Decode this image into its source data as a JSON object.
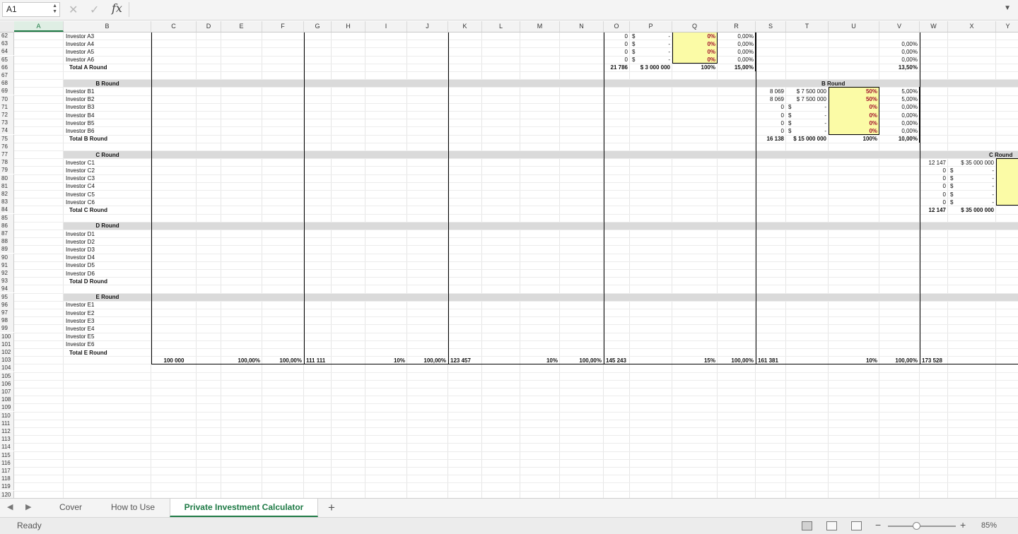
{
  "formula_bar": {
    "cell_ref": "A1",
    "cancel_icon": "✕",
    "enter_icon": "✓",
    "fx_label": "fx",
    "formula": ""
  },
  "columns": [
    {
      "id": "A",
      "w": 70
    },
    {
      "id": "B",
      "w": 124
    },
    {
      "id": "C",
      "w": 64
    },
    {
      "id": "D",
      "w": 35
    },
    {
      "id": "E",
      "w": 58
    },
    {
      "id": "F",
      "w": 59
    },
    {
      "id": "G",
      "w": 39
    },
    {
      "id": "H",
      "w": 48
    },
    {
      "id": "I",
      "w": 59
    },
    {
      "id": "J",
      "w": 58
    },
    {
      "id": "K",
      "w": 48
    },
    {
      "id": "L",
      "w": 54
    },
    {
      "id": "M",
      "w": 56
    },
    {
      "id": "N",
      "w": 62
    },
    {
      "id": "O",
      "w": 37
    },
    {
      "id": "P",
      "w": 60
    },
    {
      "id": "Q",
      "w": 64
    },
    {
      "id": "R",
      "w": 54
    },
    {
      "id": "S",
      "w": 43
    },
    {
      "id": "T",
      "w": 60
    },
    {
      "id": "U",
      "w": 72
    },
    {
      "id": "V",
      "w": 57
    },
    {
      "id": "W",
      "w": 40
    },
    {
      "id": "X",
      "w": 68
    },
    {
      "id": "Y",
      "w": 34
    }
  ],
  "first_row": 62,
  "last_row": 121,
  "rows": {
    "62": [
      [
        "B",
        "Investor A3"
      ],
      [
        "O",
        "0",
        "r"
      ],
      [
        "P",
        "$",
        "l"
      ],
      [
        "P",
        "-",
        "r"
      ],
      [
        "Q",
        "0%",
        "red"
      ],
      [
        "R",
        "0,00%",
        "r"
      ]
    ],
    "63": [
      [
        "B",
        "Investor A4"
      ],
      [
        "O",
        "0",
        "r"
      ],
      [
        "P",
        "$",
        "l"
      ],
      [
        "P",
        "-",
        "r"
      ],
      [
        "Q",
        "0%",
        "red"
      ],
      [
        "R",
        "0,00%",
        "r"
      ],
      [
        "V",
        "0,00%",
        "r"
      ]
    ],
    "64": [
      [
        "B",
        "Investor A5"
      ],
      [
        "O",
        "0",
        "r"
      ],
      [
        "P",
        "$",
        "l"
      ],
      [
        "P",
        "-",
        "r"
      ],
      [
        "Q",
        "0%",
        "red"
      ],
      [
        "R",
        "0,00%",
        "r"
      ],
      [
        "V",
        "0,00%",
        "r"
      ]
    ],
    "65": [
      [
        "B",
        "Investor A6"
      ],
      [
        "O",
        "0",
        "r"
      ],
      [
        "P",
        "$",
        "l"
      ],
      [
        "P",
        "-",
        "r"
      ],
      [
        "Q",
        "0%",
        "red"
      ],
      [
        "R",
        "0,00%",
        "r"
      ],
      [
        "V",
        "0,00%",
        "r"
      ]
    ],
    "66": [
      [
        "B",
        "Total A Round",
        "tb"
      ],
      [
        "O",
        "21 786",
        "rb"
      ],
      [
        "P",
        "$ 3 000 000",
        "rb"
      ],
      [
        "Q",
        "100%",
        "rb"
      ],
      [
        "R",
        "15,00%",
        "rb"
      ],
      [
        "V",
        "13,50%",
        "rb"
      ]
    ],
    "68": [
      [
        "B",
        "B Round",
        "cb"
      ],
      [
        "T",
        "B Round",
        "ub"
      ]
    ],
    "69": [
      [
        "B",
        "Investor B1"
      ],
      [
        "S",
        "8 069",
        "r"
      ],
      [
        "T",
        "$  7 500 000",
        "r"
      ],
      [
        "U",
        "50%",
        "red"
      ],
      [
        "V",
        "5,00%",
        "r"
      ]
    ],
    "70": [
      [
        "B",
        "Investor B2"
      ],
      [
        "S",
        "8 069",
        "r"
      ],
      [
        "T",
        "$  7 500 000",
        "r"
      ],
      [
        "U",
        "50%",
        "red"
      ],
      [
        "V",
        "5,00%",
        "r"
      ]
    ],
    "71": [
      [
        "B",
        "Investor B3"
      ],
      [
        "S",
        "0",
        "r"
      ],
      [
        "T",
        "$",
        "l"
      ],
      [
        "T",
        "-",
        "r"
      ],
      [
        "U",
        "0%",
        "red"
      ],
      [
        "V",
        "0,00%",
        "r"
      ]
    ],
    "72": [
      [
        "B",
        "Investor B4"
      ],
      [
        "S",
        "0",
        "r"
      ],
      [
        "T",
        "$",
        "l"
      ],
      [
        "T",
        "-",
        "r"
      ],
      [
        "U",
        "0%",
        "red"
      ],
      [
        "V",
        "0,00%",
        "r"
      ]
    ],
    "73": [
      [
        "B",
        "Investor B5"
      ],
      [
        "S",
        "0",
        "r"
      ],
      [
        "T",
        "$",
        "l"
      ],
      [
        "T",
        "-",
        "r"
      ],
      [
        "U",
        "0%",
        "red"
      ],
      [
        "V",
        "0,00%",
        "r"
      ]
    ],
    "74": [
      [
        "B",
        "Investor B6"
      ],
      [
        "S",
        "0",
        "r"
      ],
      [
        "T",
        "$",
        "l"
      ],
      [
        "T",
        "-",
        "r"
      ],
      [
        "U",
        "0%",
        "red"
      ],
      [
        "V",
        "0,00%",
        "r"
      ]
    ],
    "75": [
      [
        "B",
        "Total B Round",
        "tb"
      ],
      [
        "S",
        "16 138",
        "rb"
      ],
      [
        "T",
        "$ 15 000 000",
        "rb"
      ],
      [
        "U",
        "100%",
        "rb"
      ],
      [
        "V",
        "10,00%",
        "rb"
      ]
    ],
    "77": [
      [
        "B",
        "C Round",
        "cb"
      ],
      [
        "X",
        "C Round",
        "yb"
      ]
    ],
    "78": [
      [
        "B",
        "Investor C1"
      ],
      [
        "W",
        "12 147",
        "r"
      ],
      [
        "X",
        "$ 35 000 000",
        "r"
      ]
    ],
    "79": [
      [
        "B",
        "Investor C2"
      ],
      [
        "W",
        "0",
        "r"
      ],
      [
        "X",
        "$",
        "l"
      ],
      [
        "X",
        "-",
        "r"
      ]
    ],
    "80": [
      [
        "B",
        "Investor C3"
      ],
      [
        "W",
        "0",
        "r"
      ],
      [
        "X",
        "$",
        "l"
      ],
      [
        "X",
        "-",
        "r"
      ]
    ],
    "81": [
      [
        "B",
        "Investor C4"
      ],
      [
        "W",
        "0",
        "r"
      ],
      [
        "X",
        "$",
        "l"
      ],
      [
        "X",
        "-",
        "r"
      ]
    ],
    "82": [
      [
        "B",
        "Investor C5"
      ],
      [
        "W",
        "0",
        "r"
      ],
      [
        "X",
        "$",
        "l"
      ],
      [
        "X",
        "-",
        "r"
      ]
    ],
    "83": [
      [
        "B",
        "Investor C6"
      ],
      [
        "W",
        "0",
        "r"
      ],
      [
        "X",
        "$",
        "l"
      ],
      [
        "X",
        "-",
        "r"
      ]
    ],
    "84": [
      [
        "B",
        "Total C Round",
        "tb"
      ],
      [
        "W",
        "12 147",
        "rb"
      ],
      [
        "X",
        "$ 35 000 000",
        "rb"
      ]
    ],
    "86": [
      [
        "B",
        "D Round",
        "cb"
      ]
    ],
    "87": [
      [
        "B",
        "Investor D1"
      ]
    ],
    "88": [
      [
        "B",
        "Investor D2"
      ]
    ],
    "89": [
      [
        "B",
        "Investor D3"
      ]
    ],
    "90": [
      [
        "B",
        "Investor D4"
      ]
    ],
    "91": [
      [
        "B",
        "Investor D5"
      ]
    ],
    "92": [
      [
        "B",
        "Investor D6"
      ]
    ],
    "93": [
      [
        "B",
        "Total D Round",
        "tb"
      ]
    ],
    "95": [
      [
        "B",
        "E Round",
        "cb"
      ]
    ],
    "96": [
      [
        "B",
        "Investor E1"
      ]
    ],
    "97": [
      [
        "B",
        "Investor E2"
      ]
    ],
    "98": [
      [
        "B",
        "Investor E3"
      ]
    ],
    "99": [
      [
        "B",
        "Investor E4"
      ]
    ],
    "100": [
      [
        "B",
        "Investor E5"
      ]
    ],
    "101": [
      [
        "B",
        "Investor E6"
      ]
    ],
    "102": [
      [
        "B",
        "Total E Round",
        "tb"
      ]
    ],
    "103": [
      [
        "C",
        "100 000",
        "cb"
      ],
      [
        "E",
        "100,00%",
        "rb"
      ],
      [
        "F",
        "100,00%",
        "rb"
      ],
      [
        "G",
        "111 111",
        "lb"
      ],
      [
        "I",
        "10%",
        "rb"
      ],
      [
        "J",
        "100,00%",
        "rb"
      ],
      [
        "K",
        "123 457",
        "lb"
      ],
      [
        "M",
        "10%",
        "rb"
      ],
      [
        "N",
        "100,00%",
        "rb"
      ],
      [
        "N",
        "145 243",
        "xb"
      ],
      [
        "Q",
        "15%",
        "rb"
      ],
      [
        "R",
        "100,00%",
        "rb"
      ],
      [
        "S",
        "161 381",
        "lb"
      ],
      [
        "U",
        "10%",
        "rb"
      ],
      [
        "V",
        "100,00%",
        "rb"
      ],
      [
        "W",
        "173 528",
        "lb"
      ]
    ]
  },
  "sheet_tabs": [
    {
      "label": "Cover",
      "active": false
    },
    {
      "label": "How to Use",
      "active": false
    },
    {
      "label": "Private Investment Calculator",
      "active": true
    }
  ],
  "status": {
    "ready": "Ready",
    "zoom": "85%",
    "zoom_fraction": 0.42
  }
}
